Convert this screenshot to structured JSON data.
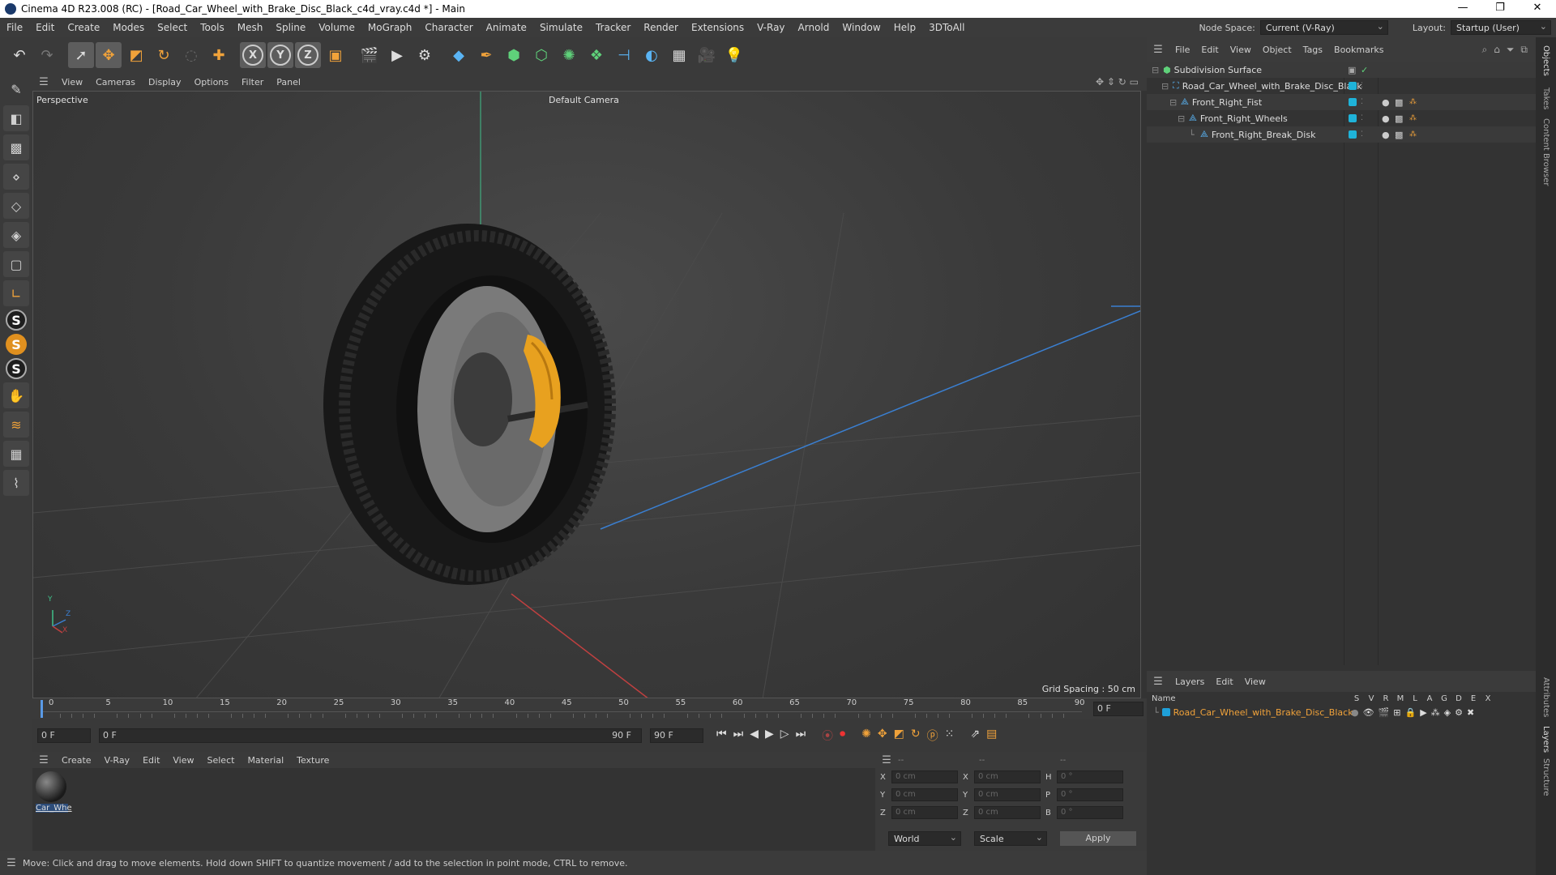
{
  "window": {
    "title": "Cinema 4D R23.008 (RC) - [Road_Car_Wheel_with_Brake_Disc_Black_c4d_vray.c4d *] - Main",
    "controls": [
      "—",
      "❐",
      "✕"
    ]
  },
  "menubar": {
    "items": [
      "File",
      "Edit",
      "Create",
      "Modes",
      "Select",
      "Tools",
      "Mesh",
      "Spline",
      "Volume",
      "MoGraph",
      "Character",
      "Animate",
      "Simulate",
      "Tracker",
      "Render",
      "Extensions",
      "V-Ray",
      "Arnold",
      "Window",
      "Help",
      "3DToAll"
    ],
    "node_space_label": "Node Space:",
    "node_space_value": "Current (V-Ray)",
    "layout_label": "Layout:",
    "layout_value": "Startup (User)"
  },
  "viewport": {
    "menu": [
      "View",
      "Cameras",
      "Display",
      "Options",
      "Filter",
      "Panel"
    ],
    "view_name": "Perspective",
    "camera": "Default Camera",
    "grid_spacing": "Grid Spacing : 50 cm",
    "axis_y": "Y",
    "axis_z": "Z",
    "axis_x": "X",
    "colors": {
      "caliper": "#e8a11f",
      "tire": "#1b1b1b",
      "disc": "#6e6e6e"
    }
  },
  "timeline": {
    "ticks": [
      "0",
      "5",
      "10",
      "15",
      "20",
      "25",
      "30",
      "35",
      "40",
      "45",
      "50",
      "55",
      "60",
      "65",
      "70",
      "75",
      "80",
      "85",
      "90"
    ],
    "current_frame": "0 F"
  },
  "transport": {
    "start": "0 F",
    "range_start": "0 F",
    "range_end": "90 F",
    "end": "90 F"
  },
  "material_manager": {
    "menu": [
      "Create",
      "V-Ray",
      "Edit",
      "View",
      "Select",
      "Material",
      "Texture"
    ],
    "material_name": "Car_Whe"
  },
  "coordinates": {
    "headers": [
      "--",
      "--",
      "--"
    ],
    "rows": [
      {
        "a": "X",
        "av": "0 cm",
        "b": "X",
        "bv": "0 cm",
        "c": "H",
        "cv": "0 °"
      },
      {
        "a": "Y",
        "av": "0 cm",
        "b": "Y",
        "bv": "0 cm",
        "c": "P",
        "cv": "0 °"
      },
      {
        "a": "Z",
        "av": "0 cm",
        "b": "Z",
        "bv": "0 cm",
        "c": "B",
        "cv": "0 °"
      }
    ],
    "mode1": "World",
    "mode2": "Scale",
    "apply": "Apply"
  },
  "status": "Move: Click and drag to move elements. Hold down SHIFT to quantize movement / add to the selection in point mode, CTRL to remove.",
  "object_manager": {
    "menu": [
      "File",
      "Edit",
      "View",
      "Object",
      "Tags",
      "Bookmarks"
    ],
    "objects": [
      {
        "name": "Subdivision Surface",
        "indent": 0
      },
      {
        "name": "Road_Car_Wheel_with_Brake_Disc_Black",
        "indent": 1
      },
      {
        "name": "Front_Right_Fist",
        "indent": 2
      },
      {
        "name": "Front_Right_Wheels",
        "indent": 3
      },
      {
        "name": "Front_Right_Break_Disk",
        "indent": 4
      }
    ]
  },
  "layers": {
    "menu": [
      "Layers",
      "Edit",
      "View"
    ],
    "name_header": "Name",
    "columns": [
      "S",
      "V",
      "R",
      "M",
      "L",
      "A",
      "G",
      "D",
      "E",
      "X"
    ],
    "items": [
      {
        "name": "Road_Car_Wheel_with_Brake_Disc_Black",
        "color": "#1fa0d9"
      }
    ]
  },
  "right_tabs": [
    "Objects",
    "Takes",
    "Content Browser",
    "Attributes",
    "Layers",
    "Structure"
  ]
}
